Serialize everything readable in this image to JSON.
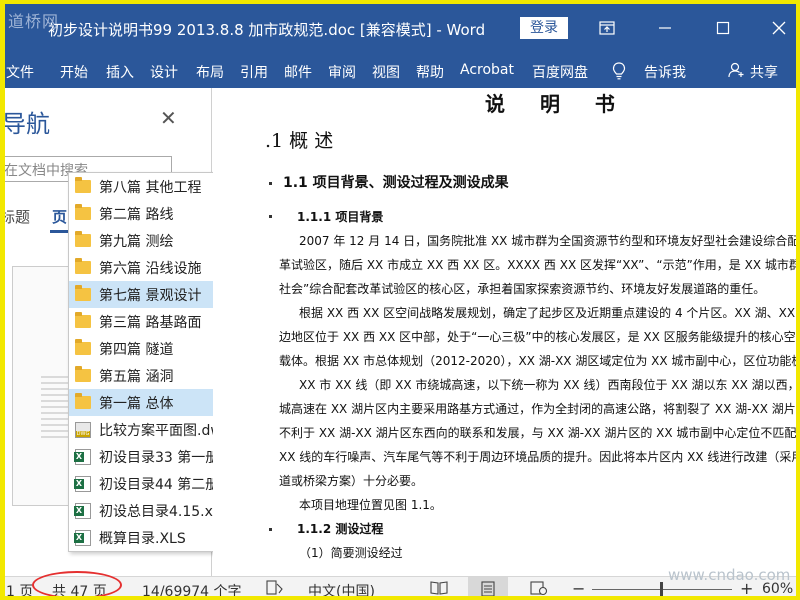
{
  "window": {
    "logo_text": "道桥网",
    "title": "初步设计说明书99  2013.8.8  加市政规范.doc [兼容模式]  -  Word",
    "login_label": "登录"
  },
  "ribbon": {
    "tabs": [
      "文件",
      "开始",
      "插入",
      "设计",
      "布局",
      "引用",
      "邮件",
      "审阅",
      "视图",
      "帮助",
      "Acrobat",
      "百度网盘"
    ],
    "tell_me": "告诉我",
    "share": "共享"
  },
  "nav": {
    "title": "导航",
    "search_placeholder": "在文档中搜索",
    "tab_headings": "标题",
    "tab_pages": "页"
  },
  "dropdown": {
    "items": [
      {
        "label": "第八篇  其他工程",
        "icon": "folder-icon"
      },
      {
        "label": "第二篇  路线",
        "icon": "folder-icon"
      },
      {
        "label": "第九篇  测绘",
        "icon": "folder-icon"
      },
      {
        "label": "第六篇  沿线设施",
        "icon": "folder-icon"
      },
      {
        "label": "第七篇  景观设计",
        "icon": "folder-icon"
      },
      {
        "label": "第三篇  路基路面",
        "icon": "folder-icon"
      },
      {
        "label": "第四篇  隧道",
        "icon": "folder-icon"
      },
      {
        "label": "第五篇  涵洞",
        "icon": "folder-icon"
      },
      {
        "label": "第一篇  总体",
        "icon": "folder-icon"
      },
      {
        "label": "比较方案平面图.dwg",
        "icon": "dwg-file-icon"
      },
      {
        "label": "初设目录33  第一册",
        "icon": "xls-file-icon"
      },
      {
        "label": "初设目录44  第二册",
        "icon": "xls-file-icon"
      },
      {
        "label": "初设总目录4.15.xls",
        "icon": "xls-file-icon"
      },
      {
        "label": "概算目录.XLS",
        "icon": "xls-file-icon"
      }
    ],
    "selected": [
      "第七篇  景观设计",
      "第一篇  总体"
    ]
  },
  "document": {
    "title": "说  明  书",
    "h1": ".1  概  述",
    "h2": "1.1   项目背景、测设过程及测设成果",
    "h3_1": "1.1.1 项目背景",
    "p1": [
      "2007 年 12 月 14 日，国务院批准 XX 城市群为全国资源节约型和环境友好型社会建设综合配套改",
      "革试验区，随后 XX 市成立 XX 西 XX 区。XXXX 西 XX 区发挥“XX”、“示范”作用，是 XX 城市群“两型",
      "社会”综合配套改革试验区的核心区，承担着国家探索资源节约、环境友好发展道路的重任。"
    ],
    "p2": [
      "根据 XX 西 XX 区空间战略发展规划，确定了起步区及近期重点建设的 4 个片区。XX 湖、XX 湖片区",
      "边地区位于 XX 西 XX 区中部，处于“一心三极”中的核心发展区，是 XX 区服务能级提升的核心空间",
      "载体。根据 XX 市总体规划（2012-2020），XX 湖-XX 湖区域定位为 XX 城市副中心，区位功能极其重要"
    ],
    "p3": [
      "XX 市 XX 线（即 XX 市绕城高速，以下统一称为 XX 线）西南段位于 XX 湖以东 XX 湖以西，由于绕",
      "城高速在 XX 湖片区内主要采用路基方式通过，作为全封闭的高速公路，将割裂了 XX 湖-XX 湖片区，",
      "不利于 XX 湖-XX 湖片区东西向的联系和发展，与 XX 湖-XX 湖片区的 XX 城市副中心定位不匹配，此外",
      "XX 线的车行噪声、汽车尾气等不利于周边环境品质的提升。因此将本片区内 XX 线进行改建（采用隧",
      "道或桥梁方案）十分必要。"
    ],
    "p4": "本项目地理位置见图 1.1。",
    "h3_2": "1.1.2  测设过程",
    "p5": "（1）简要测设经过"
  },
  "status": {
    "page": "1 页",
    "total_pages": "共 47 页",
    "word_count": "14/69974 个字",
    "language": "中文(中国)",
    "zoom": "60%",
    "site_watermark": "www.cndao.com"
  },
  "colors": {
    "word_blue": "#2b579a",
    "frame_yellow": "#f2e800",
    "highlight_circle": "#e53030",
    "selection": "#cce4f7"
  }
}
